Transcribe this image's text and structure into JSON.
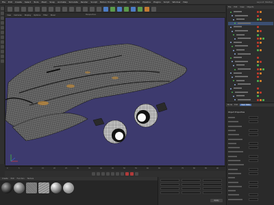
{
  "menu": {
    "items": [
      "File",
      "Edit",
      "Create",
      "Select",
      "Tools",
      "Mesh",
      "Snap",
      "Animate",
      "Simulate",
      "Render",
      "Sculpt",
      "Motion Tracker",
      "MoGraph",
      "Character",
      "Pipeline",
      "Plugins",
      "Script",
      "Window",
      "Help"
    ],
    "layout_label": "Layout: Startup"
  },
  "viewport": {
    "menus": [
      "View",
      "Cameras",
      "Display",
      "Options",
      "Filter",
      "Panel"
    ],
    "name": "Perspective",
    "background_color": "#3d3a6e"
  },
  "timeline": {
    "ticks": [
      "0",
      "5",
      "10",
      "15",
      "20",
      "25",
      "30",
      "35",
      "40",
      "45",
      "50",
      "55",
      "60",
      "65",
      "70",
      "75",
      "80",
      "85",
      "90"
    ]
  },
  "materials": {
    "menus": [
      "Create",
      "Edit",
      "Function",
      "Texture"
    ],
    "swatches": [
      {
        "name": "dark-sphere",
        "color": "#3a3a3a"
      },
      {
        "name": "gray-sphere",
        "color": "#8a8a8a"
      },
      {
        "name": "texture-a",
        "color": "#7a7a7a"
      },
      {
        "name": "texture-b",
        "color": "#9a9a9a"
      },
      {
        "name": "chrome-sphere",
        "color": "#b8b8b8"
      },
      {
        "name": "silver-sphere",
        "color": "#a0a0a0"
      }
    ]
  },
  "coordinates": {
    "apply_label": "Apply"
  },
  "object_manager": {
    "tabs": [
      "File",
      "Edit",
      "View",
      "Objects",
      "Tags",
      "Bookmarks"
    ]
  },
  "attributes": {
    "tabs": [
      "Mode",
      "Edit",
      "User Data"
    ],
    "title": "Object Properties"
  },
  "colors": {
    "accent_blue": "#4b6ea8",
    "tag_red": "#c0392b",
    "tag_orange": "#d9822b",
    "tag_green": "#4caf50"
  }
}
